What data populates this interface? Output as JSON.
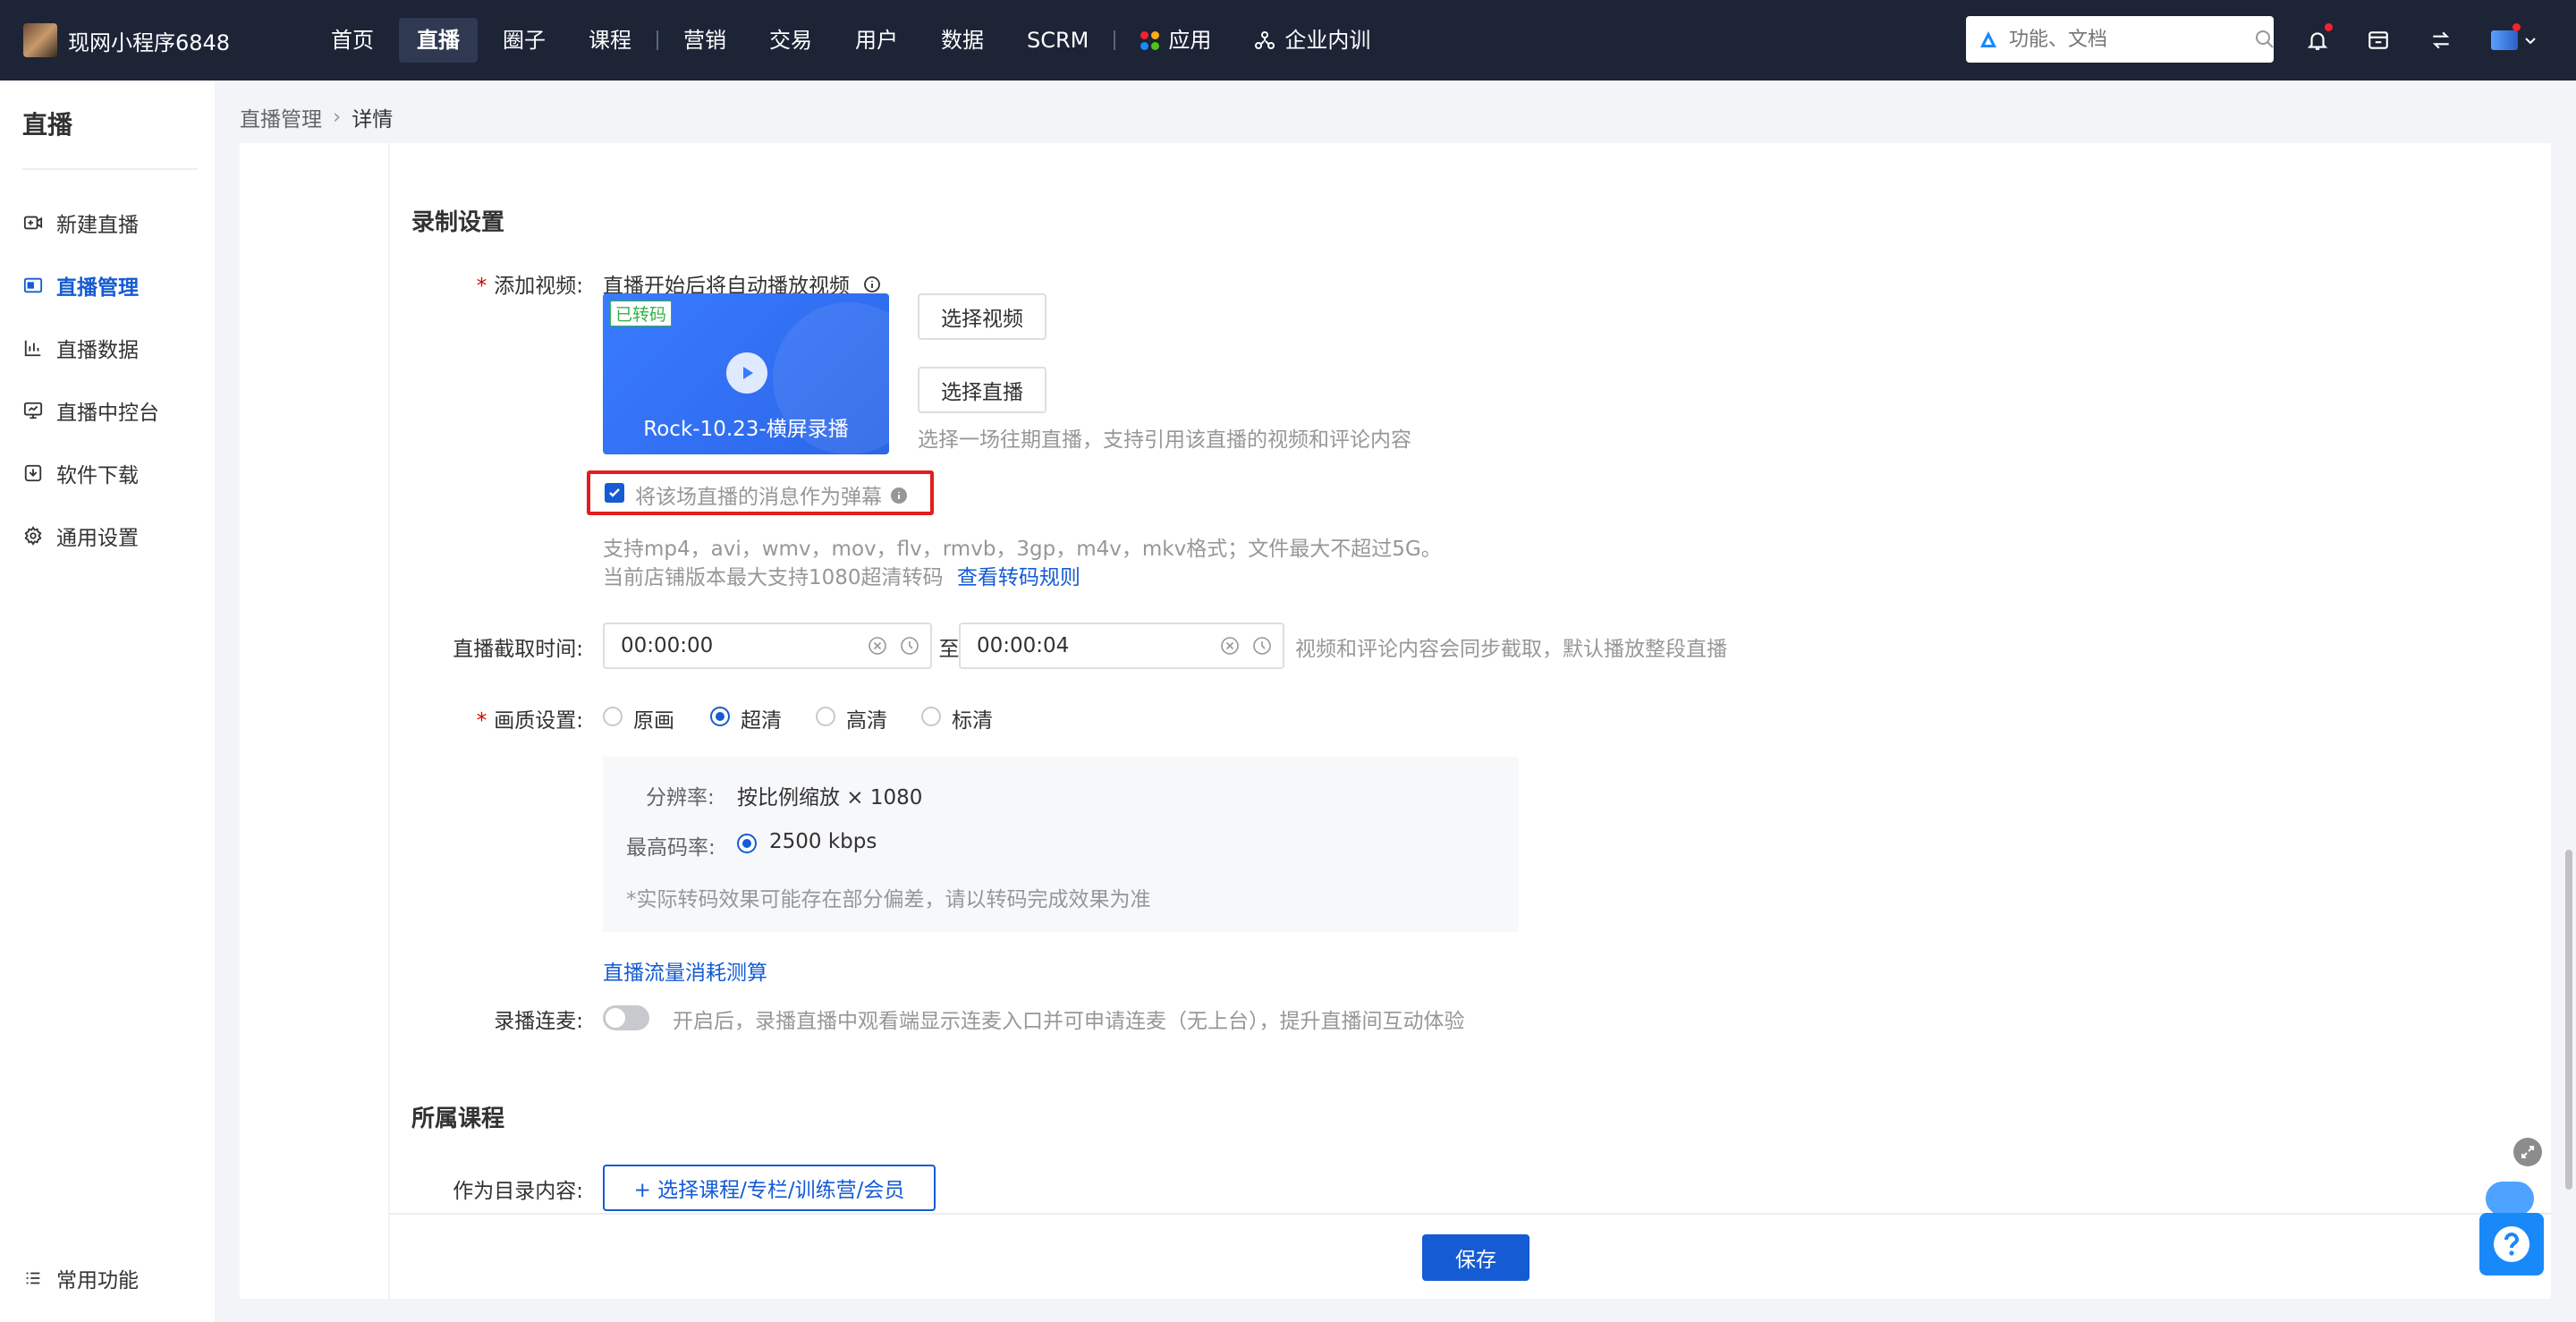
{
  "brand": {
    "name": "现网小程序6848"
  },
  "nav": {
    "items": [
      {
        "label": "首页"
      },
      {
        "label": "直播",
        "active": true
      },
      {
        "label": "圈子"
      },
      {
        "label": "课程"
      },
      {
        "label": "营销"
      },
      {
        "label": "交易"
      },
      {
        "label": "用户"
      },
      {
        "label": "数据"
      },
      {
        "label": "SCRM"
      },
      {
        "label": "应用"
      },
      {
        "label": "企业内训"
      }
    ],
    "search_placeholder": "功能、文档"
  },
  "sidebar": {
    "title": "直播",
    "items": [
      {
        "label": "新建直播",
        "icon": "new-live-icon"
      },
      {
        "label": "直播管理",
        "icon": "live-manage-icon",
        "active": true
      },
      {
        "label": "直播数据",
        "icon": "live-data-icon"
      },
      {
        "label": "直播中控台",
        "icon": "console-icon"
      },
      {
        "label": "软件下载",
        "icon": "download-icon"
      },
      {
        "label": "通用设置",
        "icon": "gear-icon"
      }
    ],
    "bottom": {
      "label": "常用功能",
      "icon": "list-icon"
    }
  },
  "breadcrumb": {
    "parent": "直播管理",
    "current": "详情"
  },
  "record": {
    "section_title": "录制设置",
    "add_video_label": "添加视频:",
    "autoplay_hint": "直播开始后将自动播放视频",
    "video": {
      "tag": "已转码",
      "name": "Rock-10.23-横屏录播"
    },
    "select_video_btn": "选择视频",
    "select_live_btn": "选择直播",
    "select_live_hint": "选择一场往期直播，支持引用该直播的视频和评论内容",
    "barrage_checkbox": "将该场直播的消息作为弹幕",
    "format_hint": "支持mp4，avi，wmv，mov，flv，rmvb，3gp，m4v，mkv格式；文件最大不超过5G。",
    "transcode_hint": "当前店铺版本最大支持1080超清转码",
    "transcode_link": "查看转码规则",
    "clip_label": "直播截取时间:",
    "clip_start": "00:00:00",
    "clip_to": "至",
    "clip_end": "00:00:04",
    "clip_hint": "视频和评论内容会同步截取，默认播放整段直播",
    "quality_label": "画质设置:",
    "quality_options": [
      "原画",
      "超清",
      "高清",
      "标清"
    ],
    "quality_selected": "超清",
    "resolution_label": "分辨率:",
    "resolution_value": "按比例缩放 × 1080",
    "bitrate_label": "最高码率:",
    "bitrate_value": "2500 kbps",
    "quality_note": "*实际转码效果可能存在部分偏差，请以转码完成效果为准",
    "traffic_link": "直播流量消耗测算",
    "mic_label": "录播连麦:",
    "mic_hint": "开启后，录播直播中观看端显示连麦入口并可申请连麦（无上台），提升直播间互动体验"
  },
  "course": {
    "section_title": "所属课程",
    "catalog_label": "作为目录内容:",
    "select_btn": "+ 选择课程/专栏/训练营/会员"
  },
  "footer": {
    "save_btn": "保存"
  },
  "colors": {
    "primary": "#155bd4",
    "topbar": "#1c2436",
    "highlight": "#e21e1e"
  }
}
